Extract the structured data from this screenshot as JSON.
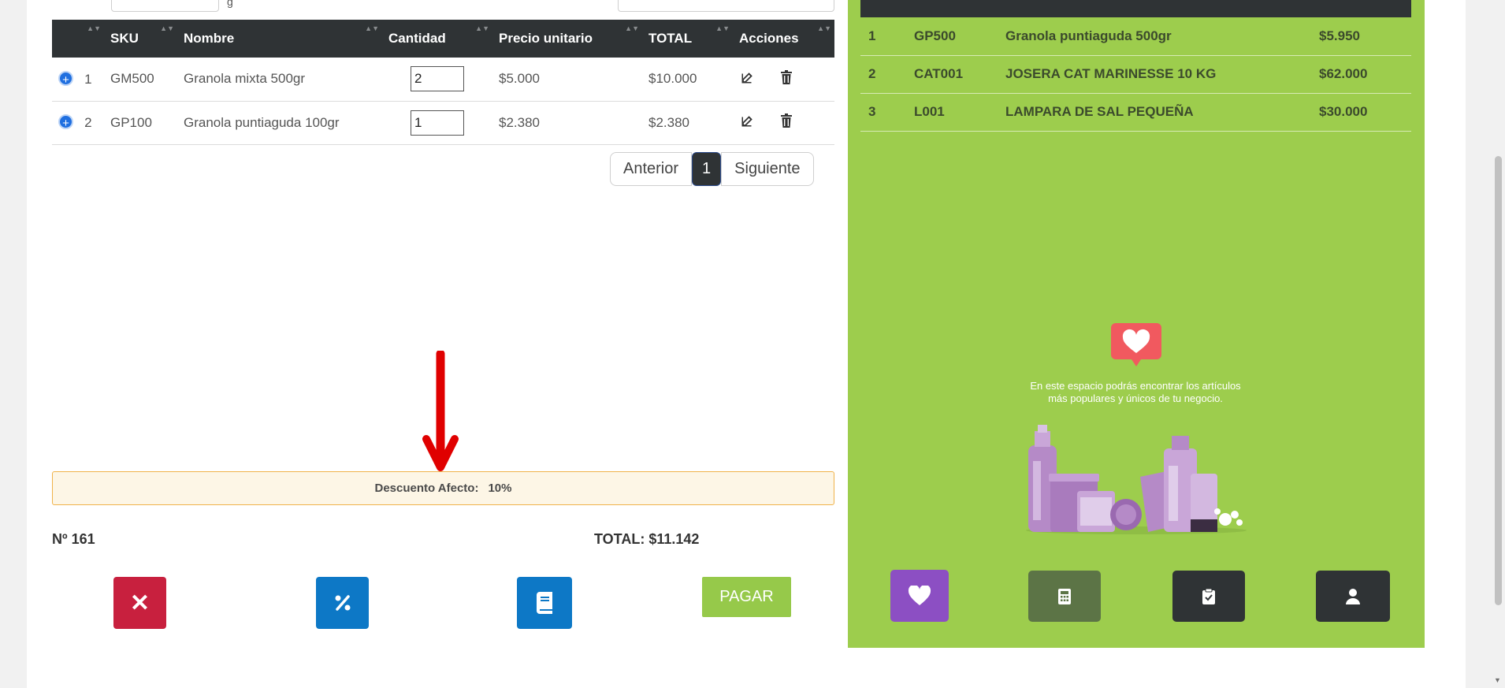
{
  "top": {
    "fragment": "g"
  },
  "table": {
    "columns": [
      "",
      "SKU",
      "Nombre",
      "Cantidad",
      "Precio unitario",
      "TOTAL",
      "Acciones"
    ],
    "rows": [
      {
        "num": "1",
        "sku": "GM500",
        "name": "Granola mixta 500gr",
        "qty": "2",
        "price": "$5.000",
        "total": "$10.000"
      },
      {
        "num": "2",
        "sku": "GP100",
        "name": "Granola puntiaguda 100gr",
        "qty": "1",
        "price": "$2.380",
        "total": "$2.380"
      }
    ]
  },
  "pagination": {
    "prev": "Anterior",
    "current": "1",
    "next": "Siguiente"
  },
  "discount": {
    "label": "Descuento Afecto:",
    "value": "10%"
  },
  "order": {
    "number": "Nº 161",
    "total": "TOTAL: $11.142"
  },
  "buttons": {
    "pay": "PAGAR"
  },
  "popular": {
    "rows": [
      {
        "num": "1",
        "sku": "GP500",
        "name": "Granola puntiaguda 500gr",
        "price": "$5.950"
      },
      {
        "num": "2",
        "sku": "CAT001",
        "name": "JOSERA CAT MARINESSE 10 KG",
        "price": "$62.000"
      },
      {
        "num": "3",
        "sku": "L001",
        "name": "LAMPARA DE SAL PEQUEÑA",
        "price": "$30.000"
      }
    ],
    "empty_text": "En este espacio podrás encontrar los artículos más populares y únicos de tu negocio."
  },
  "colors": {
    "panel_green": "#9dcd4d",
    "dark": "#2f3335",
    "cancel_red": "#c8203e",
    "blue": "#0d78c6",
    "pay_green": "#96c94a",
    "purple": "#8c4fc3",
    "olive": "#5c7446",
    "arrow_red": "#e00000"
  },
  "icons": [
    "plus-circle-icon",
    "edit-icon",
    "trash-icon",
    "close-icon",
    "percent-icon",
    "book-icon",
    "heart-icon",
    "calculator-icon",
    "clipboard-check-icon",
    "user-icon",
    "sort-icon"
  ]
}
